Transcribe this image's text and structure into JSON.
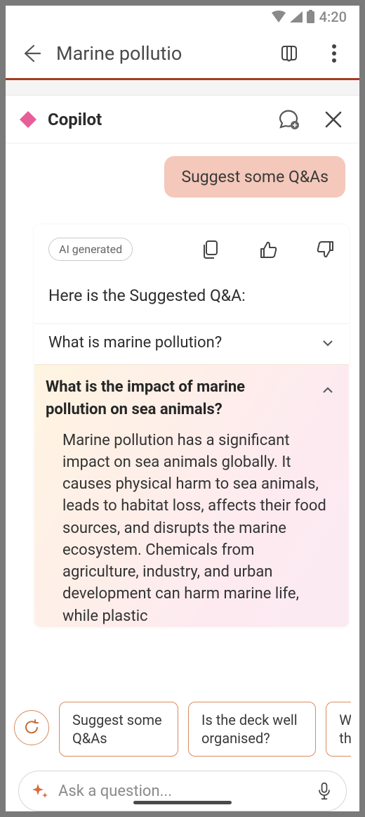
{
  "status": {
    "time": "4:20"
  },
  "header": {
    "title": "Marine pollutio"
  },
  "copilot": {
    "title": "Copilot"
  },
  "chat": {
    "user_message": "Suggest some Q&As",
    "ai_badge": "AI generated",
    "heading": "Here is the Suggested Q&A:",
    "qa": [
      {
        "question": "What is marine pollution?",
        "expanded": false
      },
      {
        "question": "What is the impact of marine pollution on sea animals?",
        "expanded": true,
        "answer": "Marine pollution has a significant impact on sea animals globally. It causes physical harm to sea animals, leads to habitat loss, affects their food sources, and disrupts the marine ecosystem. Chemicals from agriculture, industry, and urban development can harm marine life, while plastic"
      }
    ]
  },
  "suggestions": [
    "Suggest some Q&As",
    "Is the deck well organised?",
    "W\nth"
  ],
  "input": {
    "placeholder": "Ask a question..."
  },
  "colors": {
    "accent": "#a33d22",
    "chip_border": "#d98b5e",
    "user_bubble": "#f4c8ba"
  }
}
